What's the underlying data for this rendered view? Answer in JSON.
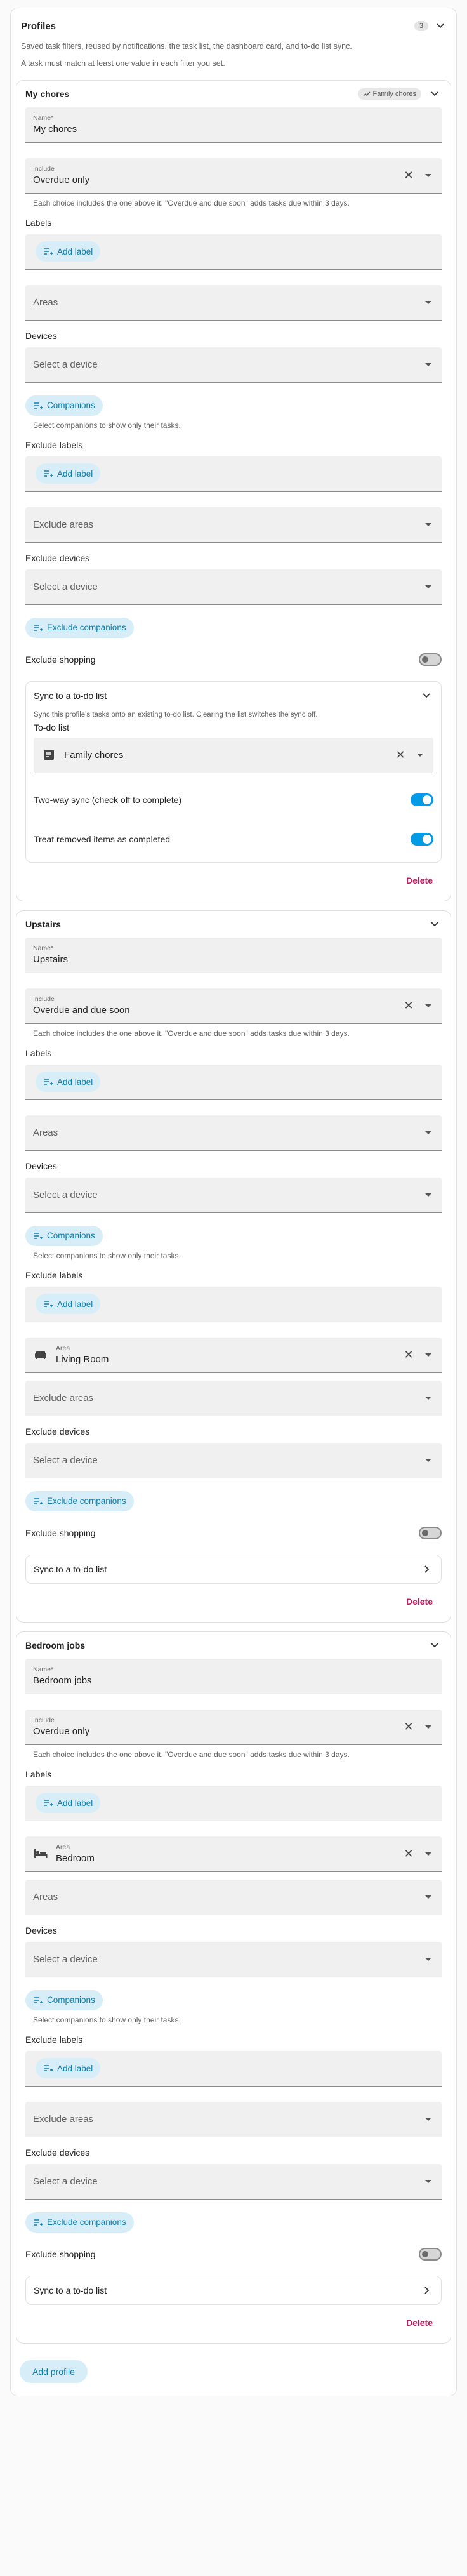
{
  "header": {
    "title": "Profiles",
    "count": "3",
    "desc1": "Saved task filters, reused by notifications, the task list, the dashboard card, and to-do list sync.",
    "desc2": "A task must match at least one value in each filter you set."
  },
  "common": {
    "name_label": "Name*",
    "include_label": "Include",
    "include_hint": "Each choice includes the one above it. \"Overdue and due soon\" adds tasks due within 3 days.",
    "labels_title": "Labels",
    "add_label": "Add label",
    "areas_placeholder": "Areas",
    "area_small": "Area",
    "devices_title": "Devices",
    "device_placeholder": "Select a device",
    "companions": "Companions",
    "companions_hint": "Select companions to show only their tasks.",
    "exclude_labels_title": "Exclude labels",
    "exclude_areas_placeholder": "Exclude areas",
    "exclude_devices_title": "Exclude devices",
    "exclude_companions": "Exclude companions",
    "exclude_shopping": "Exclude shopping",
    "sync_title": "Sync to a to-do list",
    "delete": "Delete"
  },
  "profiles": [
    {
      "title": "My chores",
      "badge": "Family chores",
      "name": "My chores",
      "include": "Overdue only",
      "sync": {
        "desc": "Sync this profile's tasks onto an existing to-do list. Clearing the list switches the sync off.",
        "todo_label": "To-do list",
        "todo_value": "Family chores",
        "two_way": "Two-way sync (check off to complete)",
        "treat_removed": "Treat removed items as completed"
      }
    },
    {
      "title": "Upstairs",
      "name": "Upstairs",
      "include": "Overdue and due soon",
      "exclude_area": "Living Room"
    },
    {
      "title": "Bedroom jobs",
      "name": "Bedroom jobs",
      "include": "Overdue only",
      "area": "Bedroom"
    }
  ],
  "footer": {
    "add_profile": "Add profile"
  },
  "colors": {
    "accent": "#039be5",
    "chip_bg": "#d7eef8",
    "chip_text": "#0b7fb0",
    "delete": "#c2185b"
  },
  "toggles": {
    "p1_exclude_shopping": false,
    "p1_two_way": true,
    "p1_treat_removed": true,
    "p2_exclude_shopping": false,
    "p3_exclude_shopping": false
  }
}
